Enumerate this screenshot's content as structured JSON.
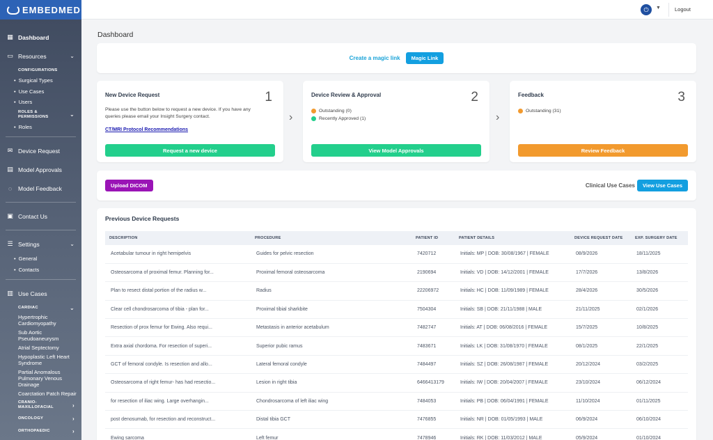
{
  "brand": {
    "name": "EMBEDMED"
  },
  "sidebar": {
    "dashboard": "Dashboard",
    "resources": "Resources",
    "configurations": "CONFIGURATIONS",
    "config_items": [
      "Surgical Types",
      "Use Cases",
      "Users"
    ],
    "roles_permissions": "ROLES & PERMISSIONS",
    "roles_items": [
      "Roles"
    ],
    "device_request": "Device Request",
    "model_approvals": "Model Approvals",
    "model_feedback": "Model Feedback",
    "contact_us": "Contact Us",
    "settings": "Settings",
    "settings_items": [
      "General",
      "Contacts"
    ],
    "use_cases": "Use Cases",
    "cardiac": "CARDIAC",
    "cardiac_items": [
      "Hypertrophic Cardiomyopathy",
      "Sub Aortic Pseudoaneurysm",
      "Atrial Septectomy",
      "Hypoplastic Left Heart Syndrome",
      "Partial Anomalous Pulmonary Venous Drainage",
      "Coarctation Patch Repair"
    ],
    "cranio": "CRANIO-MAXILLOFACIAL",
    "oncology": "ONCOLOGY",
    "orthopaedic": "ORTHOPAEDIC"
  },
  "topbar": {
    "logout": "Logout"
  },
  "page": {
    "title": "Dashboard"
  },
  "magic": {
    "label": "Create a magic link",
    "button": "Magic Link"
  },
  "steps": {
    "s1": {
      "title": "New Device Request",
      "num": "1",
      "text": "Please use the button below to request a new device. If you have any queries please email your Insight Surgery contact.",
      "link": "CT/MRI Protocol Recommendations",
      "button": "Request a new device"
    },
    "s2": {
      "title": "Device Review & Approval",
      "num": "2",
      "outstanding": "Outstanding (0)",
      "approved": "Recently Approved (1)",
      "button": "View Model Approvals"
    },
    "s3": {
      "title": "Feedback",
      "num": "3",
      "outstanding": "Outstanding (31)",
      "button": "Review Feedback"
    }
  },
  "actions": {
    "upload": "Upload DICOM",
    "clinical": "Clinical Use Cases",
    "view_use_cases": "View Use Cases"
  },
  "table": {
    "title": "Previous Device Requests",
    "headers": [
      "DESCRIPTION",
      "PROCEDURE",
      "PATIENT ID",
      "PATIENT DETAILS",
      "DEVICE REQUEST DATE",
      "EXP. SURGERY DATE"
    ],
    "rows": [
      [
        "Acetabular tumour in right hemipelvis",
        "Guides for pelvic resection",
        "7420712",
        "Initials: MP | DOB: 30/08/1967 | FEMALE",
        "08/9/2026",
        "18/11/2025"
      ],
      [
        "Osteosarcoma of proximal femur. Planning for...",
        "Proximal femoral osteosarcoma",
        "2190694",
        "Initials: VD | DOB: 14/12/2001 | FEMALE",
        "17/7/2026",
        "13/8/2026"
      ],
      [
        "Plan to resect distal portion of the radius w...",
        "Radius",
        "22206972",
        "Initials: HC | DOB: 11/09/1989 | FEMALE",
        "28/4/2026",
        "30/5/2026"
      ],
      [
        "Clear cell chondrosarcoma of tibia - plan for...",
        "Proximal tibial sharkbite",
        "7504304",
        "Initials: SB | DOB: 21/11/1988 | MALE",
        "21/11/2025",
        "02/1/2026"
      ],
      [
        "Resection of prox femur for Ewing. Also requi...",
        "Metastasis in anterior acetabulum",
        "7482747",
        "Initials: AT | DOB: 06/08/2016 | FEMALE",
        "15/7/2025",
        "10/8/2025"
      ],
      [
        "Extra axial chordoma. For resection of superi...",
        "Superior pubic ramus",
        "7483671",
        "Initials: LK | DOB: 31/08/1970 | FEMALE",
        "08/1/2025",
        "22/1/2025"
      ],
      [
        "GCT of femoral condyle. Is resection and allo...",
        "Lateral femoral condyle",
        "7484497",
        "Initials: SZ | DOB: 26/08/1987 | FEMALE",
        "20/12/2024",
        "03/2/2025"
      ],
      [
        "Osteosarcoma of right femur- has had resectio...",
        "Lesion in right tibia",
        "6466413179",
        "Initials: IW | DOB: 20/04/2007 | FEMALE",
        "23/10/2024",
        "06/12/2024"
      ],
      [
        "for resection of iliac wing. Large overhangin...",
        "Chondrosarcoma of left iliac wing",
        "7484053",
        "Initials: PB | DOB: 06/04/1991 | FEMALE",
        "11/10/2024",
        "01/11/2025"
      ],
      [
        "post denosumab, for resection and reconstruct...",
        "Distal tibia GCT",
        "7476855",
        "Initials: NR | DOB: 01/05/1993 | MALE",
        "06/9/2024",
        "06/10/2024"
      ],
      [
        "Ewing sarcoma",
        "Left femur",
        "7478946",
        "Initials: RK | DOB: 11/03/2012 | MALE",
        "05/9/2024",
        "01/10/2024"
      ]
    ]
  }
}
